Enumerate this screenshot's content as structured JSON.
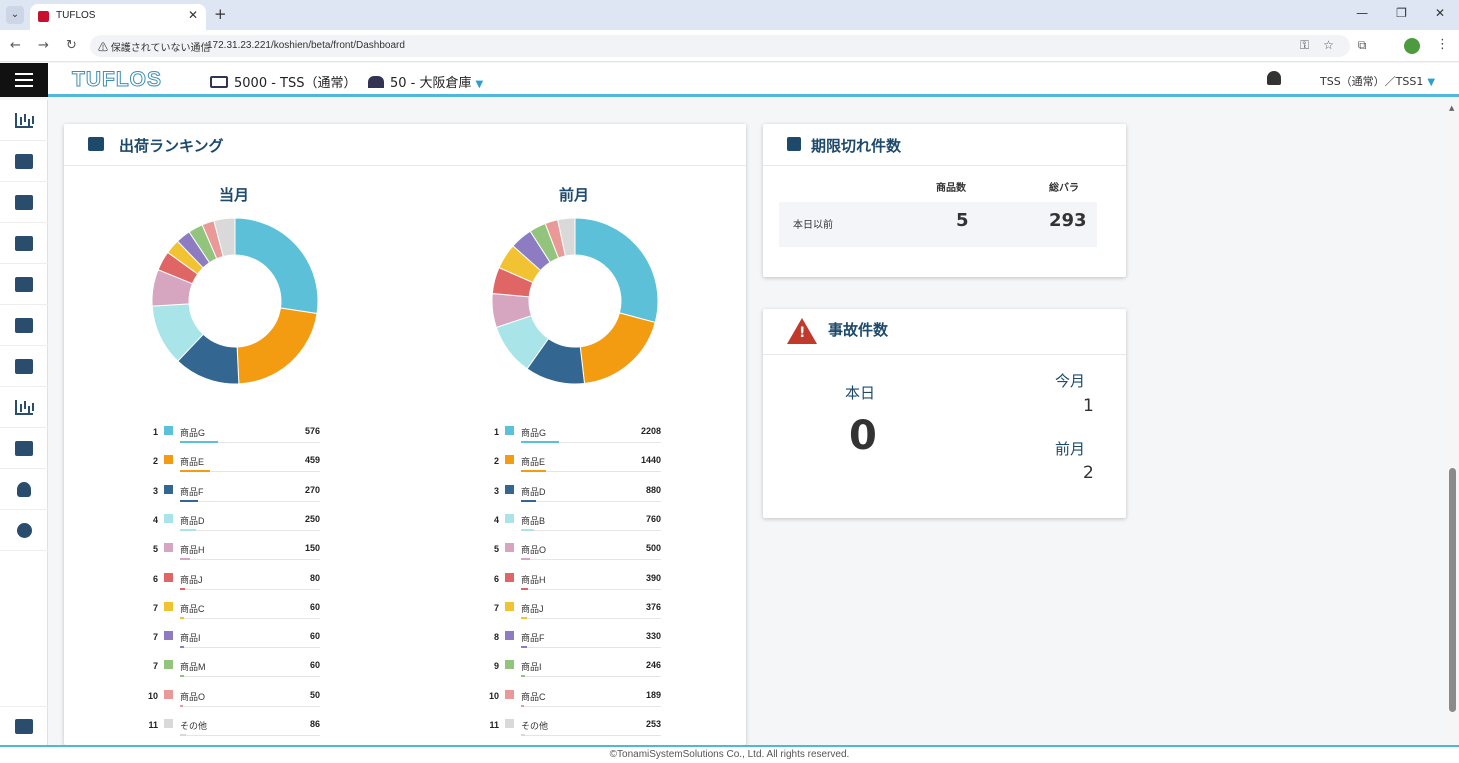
{
  "browser": {
    "tab_title": "TUFLOS",
    "url_warning": "⚠ 保護されていない通信",
    "url": "172.31.23.221/koshien/beta/front/Dashboard"
  },
  "header": {
    "logo": "TUFLOS",
    "company": "5000 - TSS（通常）",
    "warehouse": "50 - 大阪倉庫",
    "user": "TSS（通常）／TSS1"
  },
  "sidebar": {
    "icons": [
      "dashboard-icon",
      "inbound-icon",
      "outbound-icon",
      "cart-add-icon",
      "inventory-icon",
      "location-icon",
      "hourglass-icon",
      "report-icon",
      "monitor-icon",
      "user-icon",
      "settings-icon"
    ],
    "exit_icon": "logout-icon"
  },
  "ranking": {
    "title": "出荷ランキング",
    "current": {
      "label": "当月",
      "items": [
        {
          "rank": "1",
          "name": "商品G",
          "value": "576",
          "color": "#5bc0d8"
        },
        {
          "rank": "2",
          "name": "商品E",
          "value": "459",
          "color": "#f39c12"
        },
        {
          "rank": "3",
          "name": "商品F",
          "value": "270",
          "color": "#336791"
        },
        {
          "rank": "4",
          "name": "商品D",
          "value": "250",
          "color": "#a8e4e8"
        },
        {
          "rank": "5",
          "name": "商品H",
          "value": "150",
          "color": "#d6a5c0"
        },
        {
          "rank": "6",
          "name": "商品J",
          "value": "80",
          "color": "#e06666"
        },
        {
          "rank": "7",
          "name": "商品C",
          "value": "60",
          "color": "#f1c232"
        },
        {
          "rank": "7",
          "name": "商品I",
          "value": "60",
          "color": "#8e7cc3"
        },
        {
          "rank": "7",
          "name": "商品M",
          "value": "60",
          "color": "#93c47d"
        },
        {
          "rank": "10",
          "name": "商品O",
          "value": "50",
          "color": "#ea9999"
        },
        {
          "rank": "11",
          "name": "その他",
          "value": "86",
          "color": "#d9d9d9"
        }
      ]
    },
    "previous": {
      "label": "前月",
      "items": [
        {
          "rank": "1",
          "name": "商品G",
          "value": "2208",
          "color": "#5bc0d8"
        },
        {
          "rank": "2",
          "name": "商品E",
          "value": "1440",
          "color": "#f39c12"
        },
        {
          "rank": "3",
          "name": "商品D",
          "value": "880",
          "color": "#336791"
        },
        {
          "rank": "4",
          "name": "商品B",
          "value": "760",
          "color": "#a8e4e8"
        },
        {
          "rank": "5",
          "name": "商品O",
          "value": "500",
          "color": "#d6a5c0"
        },
        {
          "rank": "6",
          "name": "商品H",
          "value": "390",
          "color": "#e06666"
        },
        {
          "rank": "7",
          "name": "商品J",
          "value": "376",
          "color": "#f1c232"
        },
        {
          "rank": "8",
          "name": "商品F",
          "value": "330",
          "color": "#8e7cc3"
        },
        {
          "rank": "9",
          "name": "商品I",
          "value": "246",
          "color": "#93c47d"
        },
        {
          "rank": "10",
          "name": "商品C",
          "value": "189",
          "color": "#ea9999"
        },
        {
          "rank": "11",
          "name": "その他",
          "value": "253",
          "color": "#d9d9d9"
        }
      ]
    }
  },
  "expiry": {
    "title": "期限切れ件数",
    "col_items": "商品数",
    "col_total": "総バラ",
    "row_label": "本日以前",
    "items": "5",
    "total": "293"
  },
  "accidents": {
    "title": "事故件数",
    "today_label": "本日",
    "today_value": "0",
    "this_month_label": "今月",
    "this_month_value": "1",
    "last_month_label": "前月",
    "last_month_value": "2"
  },
  "footer": {
    "text": "©TonamiSystemSolutions Co., Ltd. All rights reserved."
  }
}
